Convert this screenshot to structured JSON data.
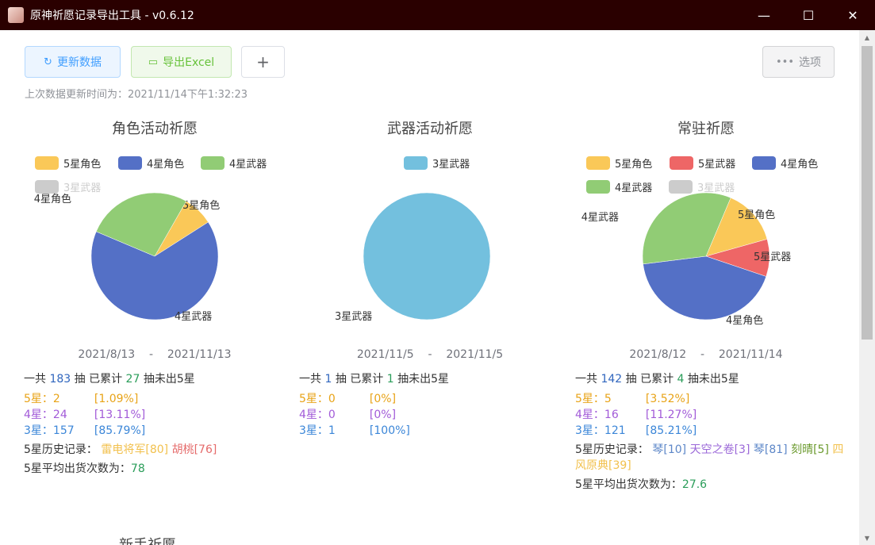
{
  "window": {
    "title": "原神祈愿记录导出工具 - v0.6.12",
    "minimize": "—",
    "maximize": "☐",
    "close": "✕"
  },
  "toolbar": {
    "refresh_label": "更新数据",
    "export_label": "导出Excel",
    "add_label": "+",
    "options_label": "选项"
  },
  "update_time": "上次数据更新时间为：2021/11/14下午1:32:23",
  "colors": {
    "five_char": "#fac858",
    "four_char": "#5470c6",
    "four_weapon": "#91cc75",
    "three_weapon": "#73c0de",
    "five_weapon": "#ee6666",
    "disabled": "#cccccc"
  },
  "panels": [
    {
      "title": "角色活动祈愿",
      "legend": [
        {
          "label": "5星角色",
          "color": "#fac858",
          "enabled": true
        },
        {
          "label": "4星角色",
          "color": "#5470c6",
          "enabled": true
        },
        {
          "label": "4星武器",
          "color": "#91cc75",
          "enabled": true
        },
        {
          "label": "3星武器",
          "color": "#cccccc",
          "enabled": false
        }
      ],
      "chart_data": {
        "type": "pie",
        "slices": [
          {
            "label": "5星角色",
            "value": 2,
            "color": "#fac858"
          },
          {
            "label": "4星角色",
            "value": 17,
            "color": "#5470c6"
          },
          {
            "label": "4星武器",
            "value": 7,
            "color": "#91cc75"
          }
        ]
      },
      "date_start": "2021/8/13",
      "date_sep": "-",
      "date_end": "2021/11/13",
      "total_prefix": "一共",
      "total": "183",
      "total_unit": "抽 已累计",
      "accum": "27",
      "accum_suffix": "抽未出5星",
      "s5_label": "5星：",
      "s5": "2",
      "s5_pct": "[1.09%]",
      "s4_label": "4星：",
      "s4": "24",
      "s4_pct": "[13.11%]",
      "s3_label": "3星：",
      "s3": "157",
      "s3_pct": "[85.79%]",
      "history_label": "5星历史记录：",
      "history": [
        {
          "text": "雷电将军[80]",
          "cls": "t5"
        },
        {
          "text": "胡桃[76]",
          "cls": "t-red"
        }
      ],
      "avg_label": "5星平均出货次数为：",
      "avg": "78"
    },
    {
      "title": "武器活动祈愿",
      "legend": [
        {
          "label": "3星武器",
          "color": "#73c0de",
          "enabled": true
        }
      ],
      "chart_data": {
        "type": "pie",
        "slices": [
          {
            "label": "3星武器",
            "value": 1,
            "color": "#73c0de"
          }
        ]
      },
      "date_start": "2021/11/5",
      "date_sep": "-",
      "date_end": "2021/11/5",
      "total_prefix": "一共",
      "total": "1",
      "total_unit": "抽 已累计",
      "accum": "1",
      "accum_suffix": "抽未出5星",
      "s5_label": "5星：",
      "s5": "0",
      "s5_pct": "[0%]",
      "s4_label": "4星：",
      "s4": "0",
      "s4_pct": "[0%]",
      "s3_label": "3星：",
      "s3": "1",
      "s3_pct": "[100%]",
      "history_label": "",
      "history": [],
      "avg_label": "",
      "avg": ""
    },
    {
      "title": "常驻祈愿",
      "legend": [
        {
          "label": "5星角色",
          "color": "#fac858",
          "enabled": true
        },
        {
          "label": "5星武器",
          "color": "#ee6666",
          "enabled": true
        },
        {
          "label": "4星角色",
          "color": "#5470c6",
          "enabled": true
        },
        {
          "label": "4星武器",
          "color": "#91cc75",
          "enabled": true
        },
        {
          "label": "3星武器",
          "color": "#cccccc",
          "enabled": false
        }
      ],
      "chart_data": {
        "type": "pie",
        "slices": [
          {
            "label": "5星角色",
            "value": 3,
            "color": "#fac858"
          },
          {
            "label": "5星武器",
            "value": 2,
            "color": "#ee6666"
          },
          {
            "label": "4星角色",
            "value": 9,
            "color": "#5470c6"
          },
          {
            "label": "4星武器",
            "value": 7,
            "color": "#91cc75"
          }
        ]
      },
      "date_start": "2021/8/12",
      "date_sep": "-",
      "date_end": "2021/11/14",
      "total_prefix": "一共",
      "total": "142",
      "total_unit": "抽 已累计",
      "accum": "4",
      "accum_suffix": "抽未出5星",
      "s5_label": "5星：",
      "s5": "5",
      "s5_pct": "[3.52%]",
      "s4_label": "4星：",
      "s4": "16",
      "s4_pct": "[11.27%]",
      "s3_label": "3星：",
      "s3": "121",
      "s3_pct": "[85.21%]",
      "history_label": "5星历史记录：",
      "history": [
        {
          "text": "琴[10]",
          "cls": "t-blue"
        },
        {
          "text": "天空之卷[3]",
          "cls": "t-purple"
        },
        {
          "text": "琴[81]",
          "cls": "t-blue"
        },
        {
          "text": "刻晴[5]",
          "cls": "t-green"
        },
        {
          "text": "四风原典[39]",
          "cls": "t5"
        }
      ],
      "avg_label": "5星平均出货次数为：",
      "avg": "27.6"
    }
  ],
  "bottom_title": "新手祈愿"
}
